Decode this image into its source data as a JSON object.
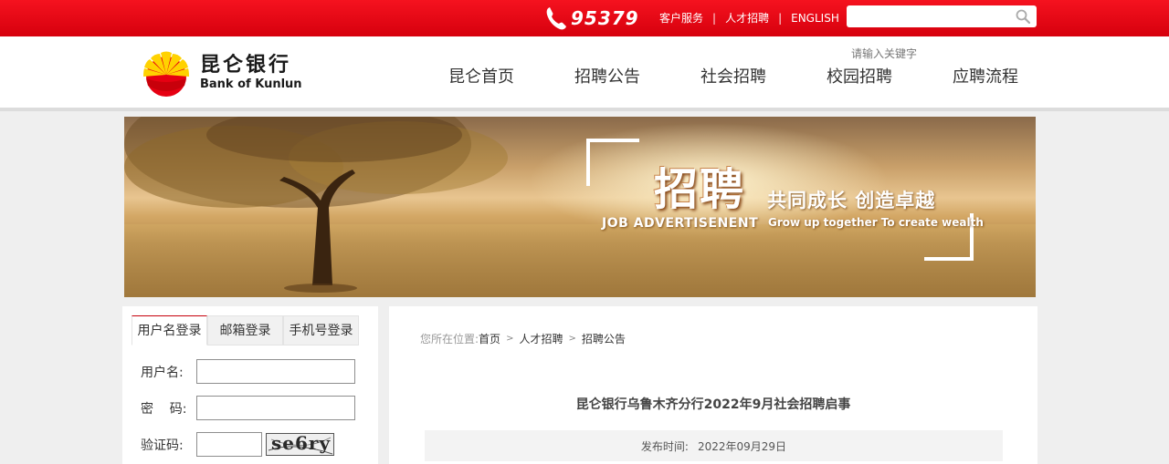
{
  "topbar": {
    "phone": "95379",
    "links": [
      "客户服务",
      "人才招聘",
      "ENGLISH"
    ],
    "separator": "|",
    "search_value": ""
  },
  "header": {
    "logo_cn": "昆仑银行",
    "logo_en": "Bank of Kunlun",
    "search_hint": "请输入关键字",
    "nav": [
      "昆仑首页",
      "招聘公告",
      "社会招聘",
      "校园招聘",
      "应聘流程"
    ]
  },
  "banner": {
    "title": "招聘",
    "subtitle": "共同成长  创造卓越",
    "en_left": "JOB  ADVERTISENENT",
    "en_right": "Grow up together To create wealth"
  },
  "login": {
    "tabs": [
      "用户名登录",
      "邮箱登录",
      "手机号登录"
    ],
    "active_tab": 0,
    "username_label": "用户名:",
    "password_label": "密    码:",
    "captcha_label": "验证码:",
    "username_value": "",
    "password_value": "",
    "captcha_value": "",
    "captcha_image_text": "se6ry"
  },
  "content": {
    "crumb_prefix": "您所在位置:",
    "crumbs": [
      "首页",
      "人才招聘",
      "招聘公告"
    ],
    "crumb_arrow": ">",
    "article_title": "昆仑银行乌鲁木齐分行2022年9月社会招聘启事",
    "pub_label": "发布时间:",
    "pub_date": "2022年09月29日"
  },
  "colors": {
    "brand_red": "#d6000d",
    "tab_accent": "#c7000b"
  }
}
